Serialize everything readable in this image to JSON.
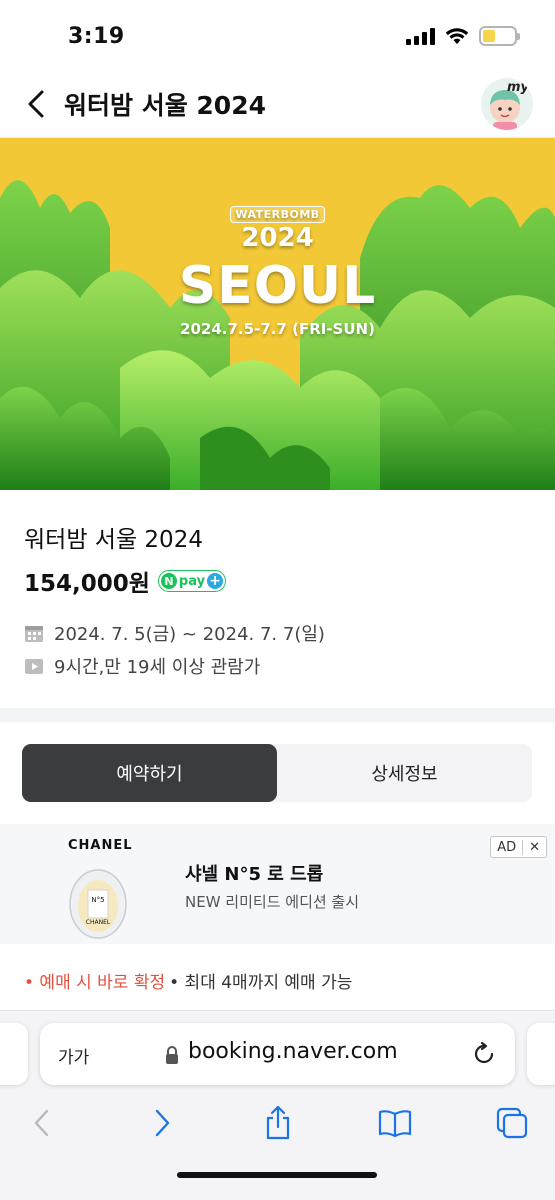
{
  "status_bar": {
    "time": "3:19"
  },
  "header": {
    "title": "워터밤 서울 2024",
    "avatar_label": "my"
  },
  "banner": {
    "brand": "WATERBOMB",
    "year": "2024",
    "city": "SEOUL",
    "dates": "2024.7.5-7.7 (FRI-SUN)"
  },
  "product": {
    "name": "워터밤 서울 2024",
    "price": "154,000원",
    "npay_n": "N",
    "npay_label": "pay",
    "npay_plus": "+",
    "date_range": "2024. 7. 5(금) ~ 2024. 7. 7(일)",
    "duration_age": "9시간,만 19세 이상 관람가"
  },
  "tabs": [
    {
      "label": "예약하기",
      "active": true
    },
    {
      "label": "상세정보",
      "active": false
    }
  ],
  "ad": {
    "brand": "CHANEL",
    "bottle_label": "CHANEL",
    "bottle_num": "N°5",
    "title": "샤넬 N°5 로 드롭",
    "subtitle": "NEW 리미티드 에디션 출시",
    "badge": "AD",
    "close": "✕"
  },
  "notice": {
    "highlight": "• 예매 시 바로 확정",
    "text": "• 최대 4매까지 예매 가능"
  },
  "safari": {
    "text_size": "가가",
    "url": "booking.naver.com"
  },
  "colors": {
    "banner_yellow": "#f2c836",
    "banner_green": "#3fae2a",
    "npay_green": "#19c35a",
    "active_tab": "#3b3c40",
    "notice_red": "#e2513f",
    "ios_blue": "#1a73e8"
  }
}
